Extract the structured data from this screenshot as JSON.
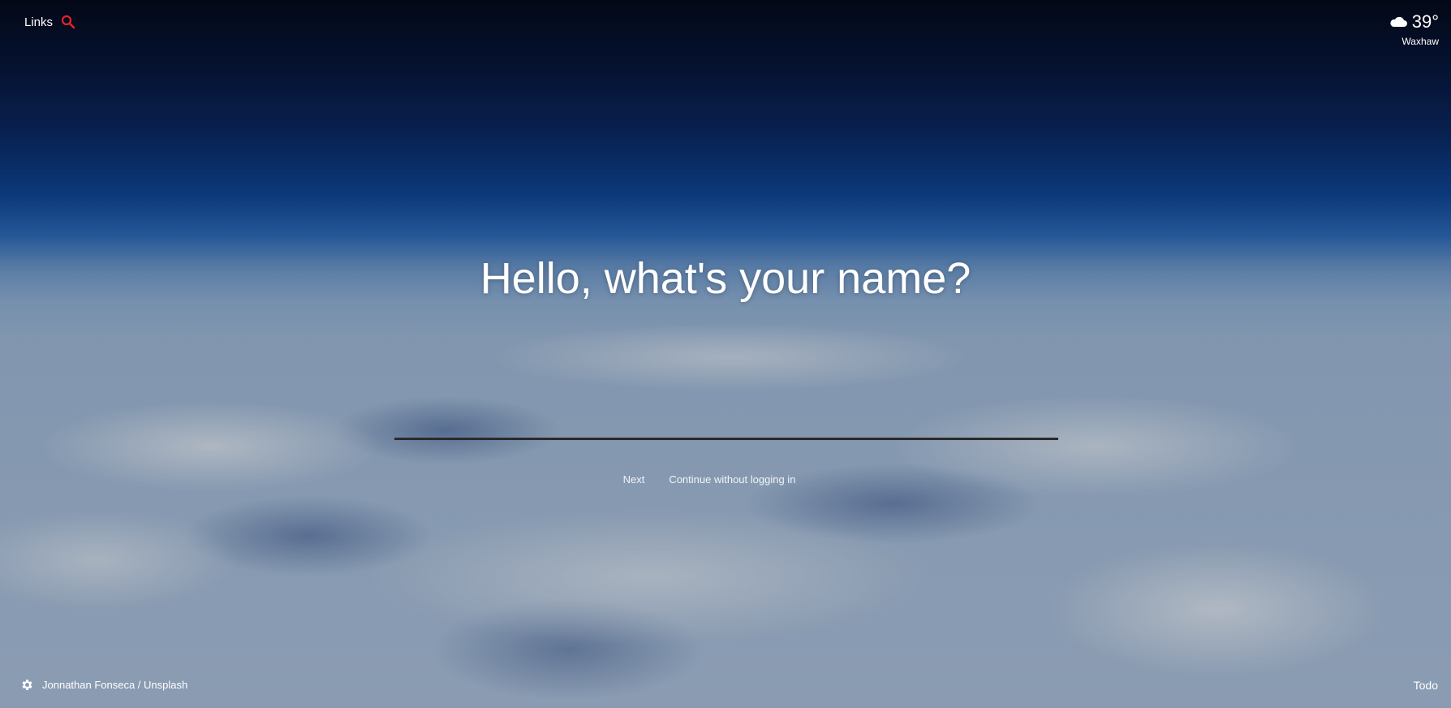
{
  "header": {
    "links_label": "Links",
    "search_icon": "search-icon",
    "accent_color": "#e0242a"
  },
  "weather": {
    "icon": "cloud-icon",
    "temperature": "39°",
    "location": "Waxhaw"
  },
  "onboarding": {
    "prompt": "Hello, what's your name?",
    "name_value": "",
    "next_label": "Next",
    "skip_label": "Continue without logging in"
  },
  "footer": {
    "settings_icon": "gear-icon",
    "photo_credit": "Jonnathan Fonseca / Unsplash",
    "todo_label": "Todo"
  }
}
